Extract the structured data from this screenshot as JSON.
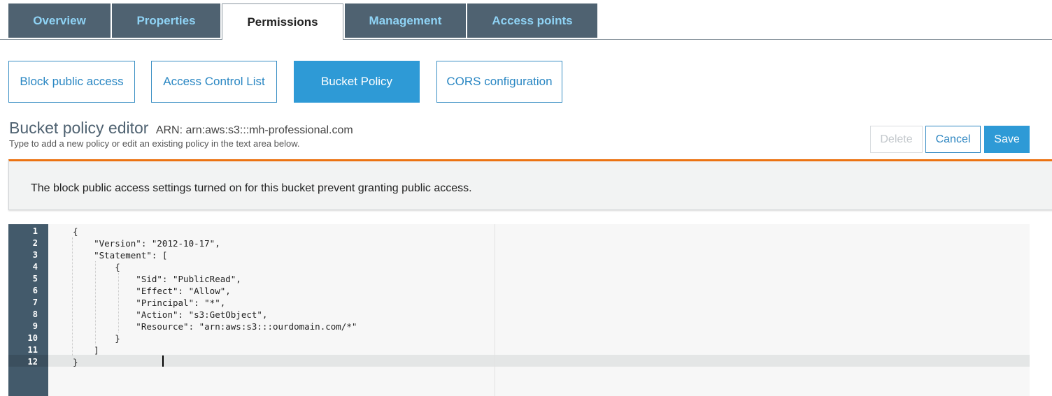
{
  "tabs": [
    {
      "label": "Overview",
      "active": false
    },
    {
      "label": "Properties",
      "active": false
    },
    {
      "label": "Permissions",
      "active": true
    },
    {
      "label": "Management",
      "active": false
    },
    {
      "label": "Access points",
      "active": false
    }
  ],
  "subtabs": [
    {
      "label": "Block public access",
      "active": false
    },
    {
      "label": "Access Control List",
      "active": false
    },
    {
      "label": "Bucket Policy",
      "active": true
    },
    {
      "label": "CORS configuration",
      "active": false
    }
  ],
  "editor_header": {
    "title": "Bucket policy editor",
    "arn": "ARN: arn:aws:s3:::mh-professional.com",
    "subtitle": "Type to add a new policy or edit an existing policy in the text area below."
  },
  "actions": {
    "delete_label": "Delete",
    "cancel_label": "Cancel",
    "save_label": "Save"
  },
  "warning": {
    "text": "The block public access settings turned on for this bucket prevent granting public access."
  },
  "code": {
    "active_line": 12,
    "lines": [
      "{",
      "    \"Version\": \"2012-10-17\",",
      "    \"Statement\": [",
      "        {",
      "            \"Sid\": \"PublicRead\",",
      "            \"Effect\": \"Allow\",",
      "            \"Principal\": \"*\",",
      "            \"Action\": \"s3:GetObject\",",
      "            \"Resource\": \"arn:aws:s3:::ourdomain.com/*\"",
      "        }",
      "    ]",
      "}"
    ]
  },
  "colors": {
    "tab_bg": "#4f6271",
    "tab_text": "#8fd3f5",
    "accent_blue": "#2e9ad6",
    "warning_border": "#ec7211",
    "gutter_bg": "#435a6b"
  }
}
